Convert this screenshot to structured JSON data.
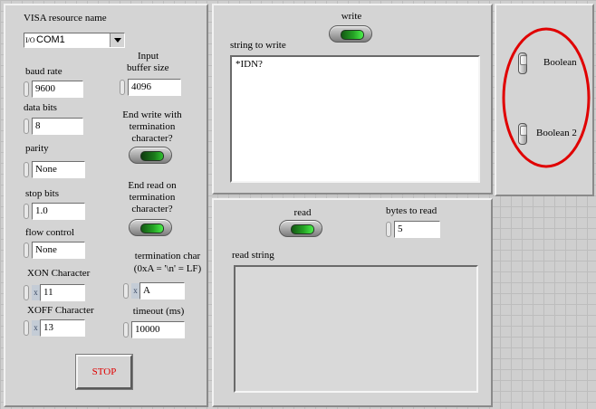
{
  "serial": {
    "visa_label": "VISA resource name",
    "visa_prefix": "I/O",
    "visa_value": "COM1",
    "baud_rate_label": "baud rate",
    "baud_rate": "9600",
    "input_buffer_label_1": "Input",
    "input_buffer_label_2": "buffer size",
    "input_buffer": "4096",
    "data_bits_label": "data bits",
    "data_bits": "8",
    "end_write_label_1": "End write with",
    "end_write_label_2": "termination",
    "end_write_label_3": "character?",
    "parity_label": "parity",
    "parity": "None",
    "stop_bits_label": "stop bits",
    "stop_bits": "1.0",
    "end_read_label_1": "End read on",
    "end_read_label_2": "termination",
    "end_read_label_3": "character?",
    "flow_control_label": "flow control",
    "flow_control": "None",
    "termchar_label_1": "termination char",
    "termchar_label_2": "(0xA = '\\n' = LF)",
    "termchar_value": "A",
    "xon_label": "XON Character",
    "xon_value": "11",
    "xoff_label": "XOFF Character",
    "xoff_value": "13",
    "timeout_label": "timeout (ms)",
    "timeout_value": "10000",
    "hex_tag": "x",
    "stop_label": "STOP"
  },
  "write": {
    "button_label": "write",
    "string_label": "string to write",
    "string_value": "*IDN?"
  },
  "read": {
    "button_label": "read",
    "bytes_label": "bytes to read",
    "bytes_value": "5",
    "string_label": "read string",
    "string_value": ""
  },
  "booleans": {
    "boolean_1_label": "Boolean",
    "boolean_2_label": "Boolean 2"
  },
  "colors": {
    "panel": "#d4d4d4",
    "stop_text": "#e00000",
    "highlight_ellipse": "#e00000",
    "led_green": "#2fc02f"
  }
}
